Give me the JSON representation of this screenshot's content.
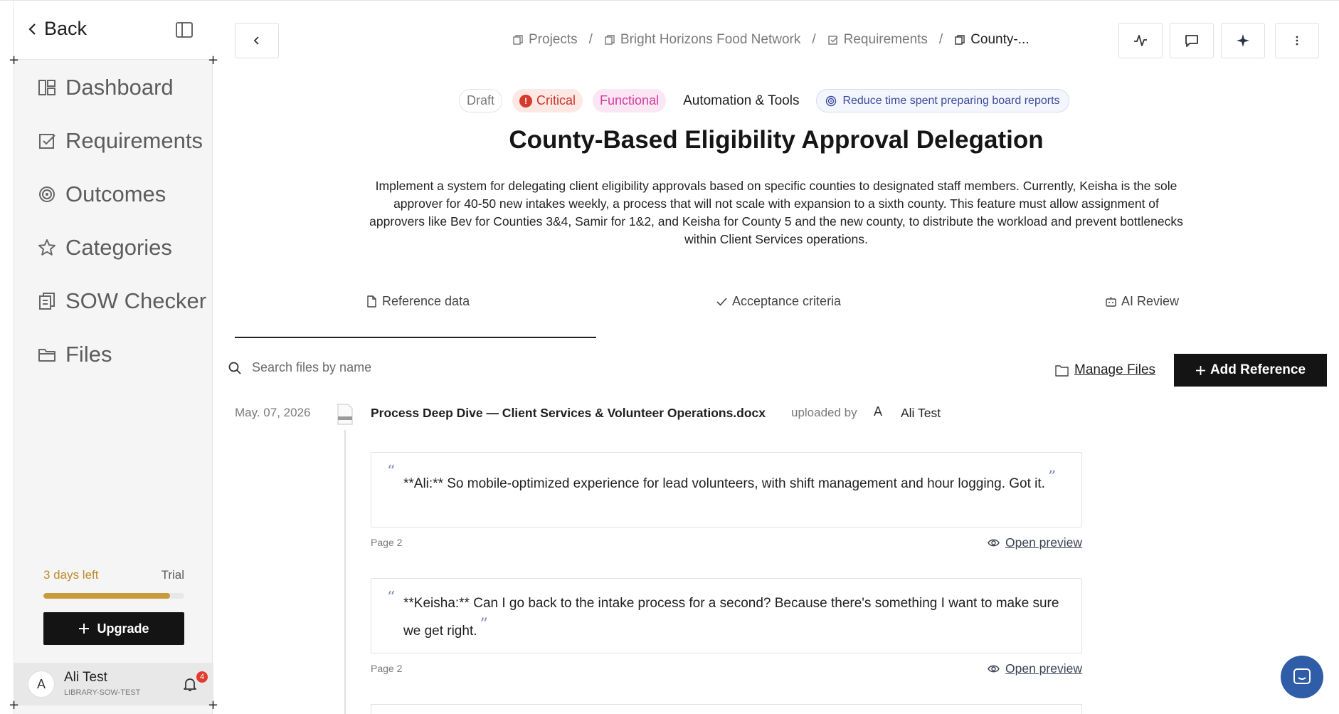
{
  "sidebar": {
    "back_label": "Back",
    "nav": [
      {
        "label": "Dashboard",
        "icon": "dashboard-icon"
      },
      {
        "label": "Requirements",
        "icon": "checklist-icon"
      },
      {
        "label": "Outcomes",
        "icon": "target-icon"
      },
      {
        "label": "Categories",
        "icon": "star-icon"
      },
      {
        "label": "SOW Checker",
        "icon": "document-check-icon"
      },
      {
        "label": "Files",
        "icon": "folder-icon"
      }
    ],
    "trial": {
      "days_left": "3 days left",
      "plan": "Trial",
      "progress_fraction": 0.9,
      "color": "#c89a3a"
    },
    "upgrade_label": "Upgrade",
    "user": {
      "initial": "A",
      "name": "Ali Test",
      "org": "LIBRARY-SOW-TEST",
      "notification_count": "4"
    }
  },
  "header": {
    "breadcrumb": [
      "Projects",
      "Bright Horizons Food Network",
      "Requirements",
      "County-..."
    ],
    "separator": "/"
  },
  "requirement": {
    "tags": {
      "status": "Draft",
      "priority": "Critical",
      "type": "Functional",
      "category": "Automation & Tools",
      "outcome": "Reduce time spent preparing board reports"
    },
    "title": "County-Based Eligibility Approval Delegation",
    "description": "Implement a system for delegating client eligibility approvals based on specific counties to designated staff members. Currently, Keisha is the sole approver for 40-50 new intakes weekly, a process that will not scale with expansion to a sixth county. This feature must allow assignment of approvers like Bev for Counties 3&4, Samir for 1&2, and Keisha for County 5 and the new county, to distribute the workload and prevent bottlenecks within Client Services operations."
  },
  "tabs": [
    "Reference data",
    "Acceptance criteria",
    "AI Review"
  ],
  "references": {
    "search_placeholder": "Search files by name",
    "manage_label": "Manage Files",
    "add_label": "Add Reference",
    "file": {
      "date": "May. 07, 2026",
      "name": "Process Deep Dive — Client Services & Volunteer Operations.docx",
      "uploaded_by_label": "uploaded by",
      "uploader_initial": "A",
      "uploader": "Ali Test"
    },
    "quotes": [
      {
        "text": "**Ali:** So mobile-optimized experience for lead volunteers, with shift management and hour logging. Got it.",
        "page": "Page 2",
        "preview_label": "Open preview"
      },
      {
        "text": "**Keisha:** Can I go back to the intake process for a second? Because there's something I want to make sure we get right.",
        "page": "Page 2",
        "preview_label": "Open preview"
      }
    ]
  },
  "colors": {
    "accent_dark": "#141414",
    "critical": "#d63a2c",
    "functional": "#d43a9c",
    "outcome": "#3b4a9c",
    "chat": "#2f5da8"
  }
}
